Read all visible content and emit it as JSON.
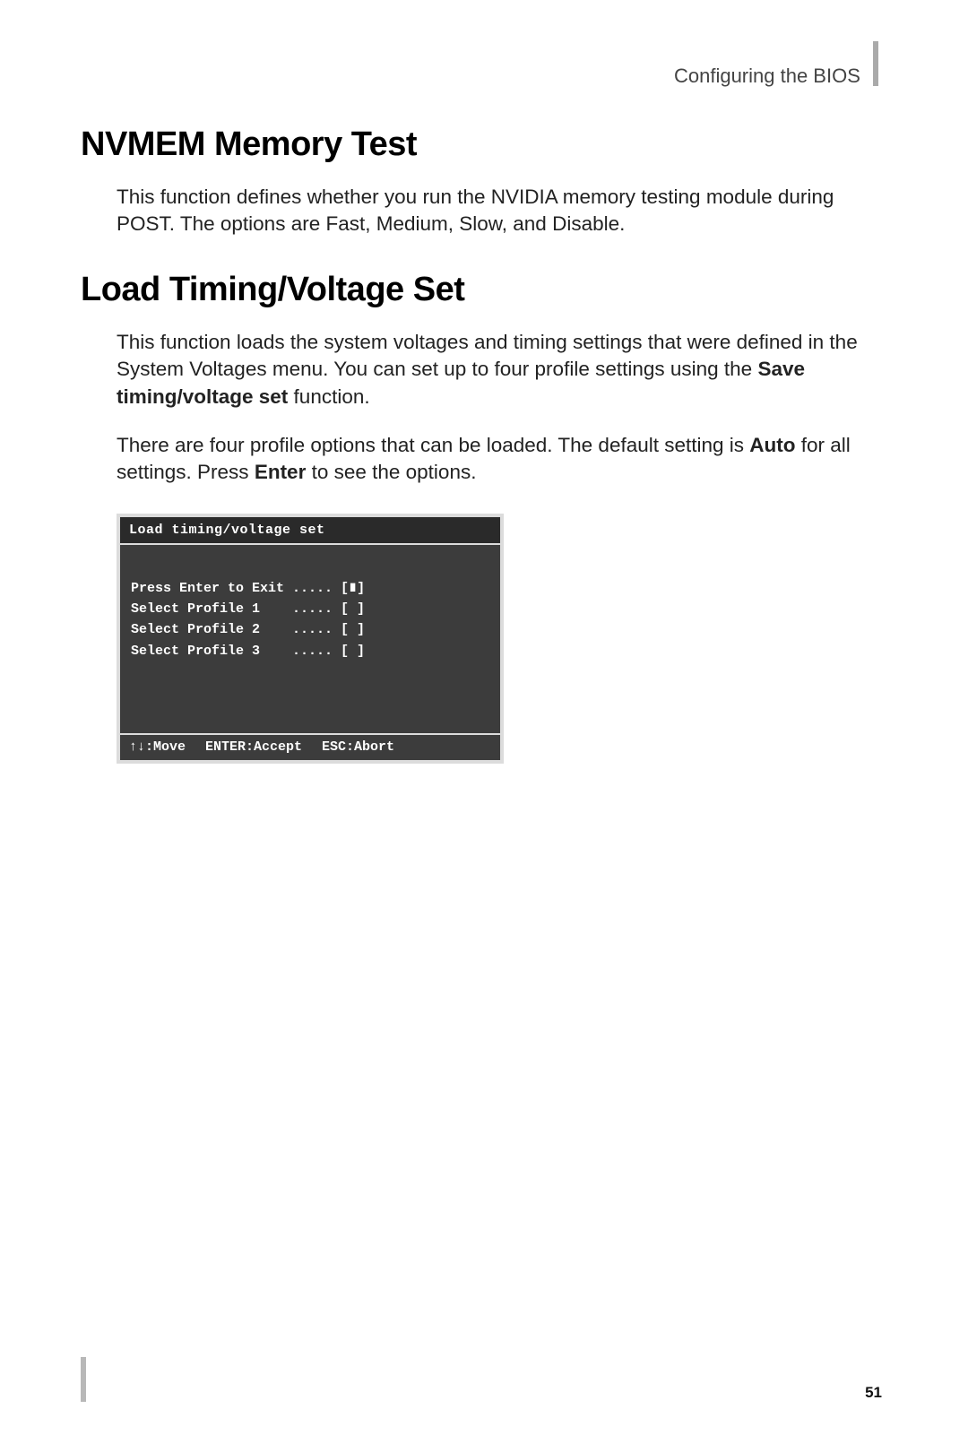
{
  "header": {
    "text": "Configuring the BIOS"
  },
  "section1": {
    "heading": "NVMEM Memory Test",
    "para1": "This function defines whether you run the NVIDIA memory testing module during POST. The options are Fast, Medium, Slow, and Disable."
  },
  "section2": {
    "heading": "Load Timing/Voltage Set",
    "para1_a": "This function loads the system voltages and timing settings that were defined in the System Voltages menu. You can set up to four profile settings using the ",
    "para1_bold": "Save timing/voltage set",
    "para1_b": " function.",
    "para2_a": "There are four profile options that can be loaded. The default setting is ",
    "para2_bold1": "Auto",
    "para2_b": " for all settings. Press ",
    "para2_bold2": "Enter",
    "para2_c": " to see the options."
  },
  "bios": {
    "title": "Load timing/voltage set",
    "rows": [
      {
        "label": "Press Enter to Exit ..... [∎]"
      },
      {
        "label": "Select Profile 1    ..... [ ]"
      },
      {
        "label": "Select Profile 2    ..... [ ]"
      },
      {
        "label": "Select Profile 3    ..... [ ]"
      }
    ],
    "footer": {
      "move": "↑↓:Move",
      "accept": "ENTER:Accept",
      "abort": "ESC:Abort"
    }
  },
  "page_number": "51"
}
